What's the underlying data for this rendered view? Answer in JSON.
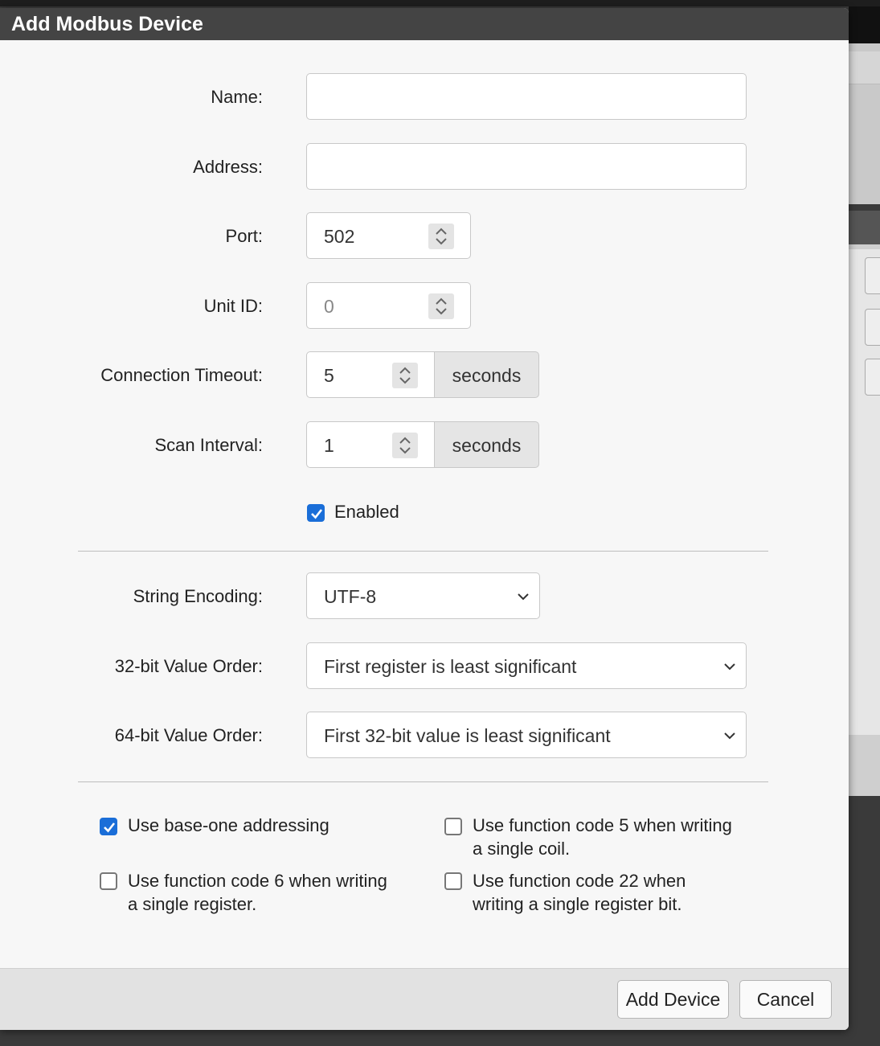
{
  "dialog": {
    "title": "Add Modbus Device"
  },
  "form": {
    "name": {
      "label": "Name:",
      "value": ""
    },
    "address": {
      "label": "Address:",
      "value": ""
    },
    "port": {
      "label": "Port:",
      "value": "502"
    },
    "unit_id": {
      "label": "Unit ID:",
      "placeholder": "0"
    },
    "connection_timeout": {
      "label": "Connection Timeout:",
      "value": "5",
      "unit": "seconds"
    },
    "scan_interval": {
      "label": "Scan Interval:",
      "value": "1",
      "unit": "seconds"
    },
    "enabled": {
      "label": "Enabled",
      "checked": true
    },
    "string_encoding": {
      "label": "String Encoding:",
      "selected": "UTF-8"
    },
    "order_32": {
      "label": "32-bit Value Order:",
      "selected": "First register is least significant"
    },
    "order_64": {
      "label": "64-bit Value Order:",
      "selected": "First 32-bit value is least significant"
    }
  },
  "options": {
    "base_one": {
      "line1": "Use base-one addressing",
      "checked": true
    },
    "fc5": {
      "line1": "Use function code 5 when writing",
      "line2": "a single coil.",
      "checked": false
    },
    "fc6": {
      "line1": "Use function code 6 when writing",
      "line2": "a single register.",
      "checked": false
    },
    "fc22": {
      "line1": "Use function code 22 when",
      "line2": "writing a single register bit.",
      "checked": false
    }
  },
  "footer": {
    "add_label": "Add Device",
    "cancel_label": "Cancel"
  },
  "colors": {
    "accent": "#1a6ed8",
    "titlebar": "#444444"
  }
}
